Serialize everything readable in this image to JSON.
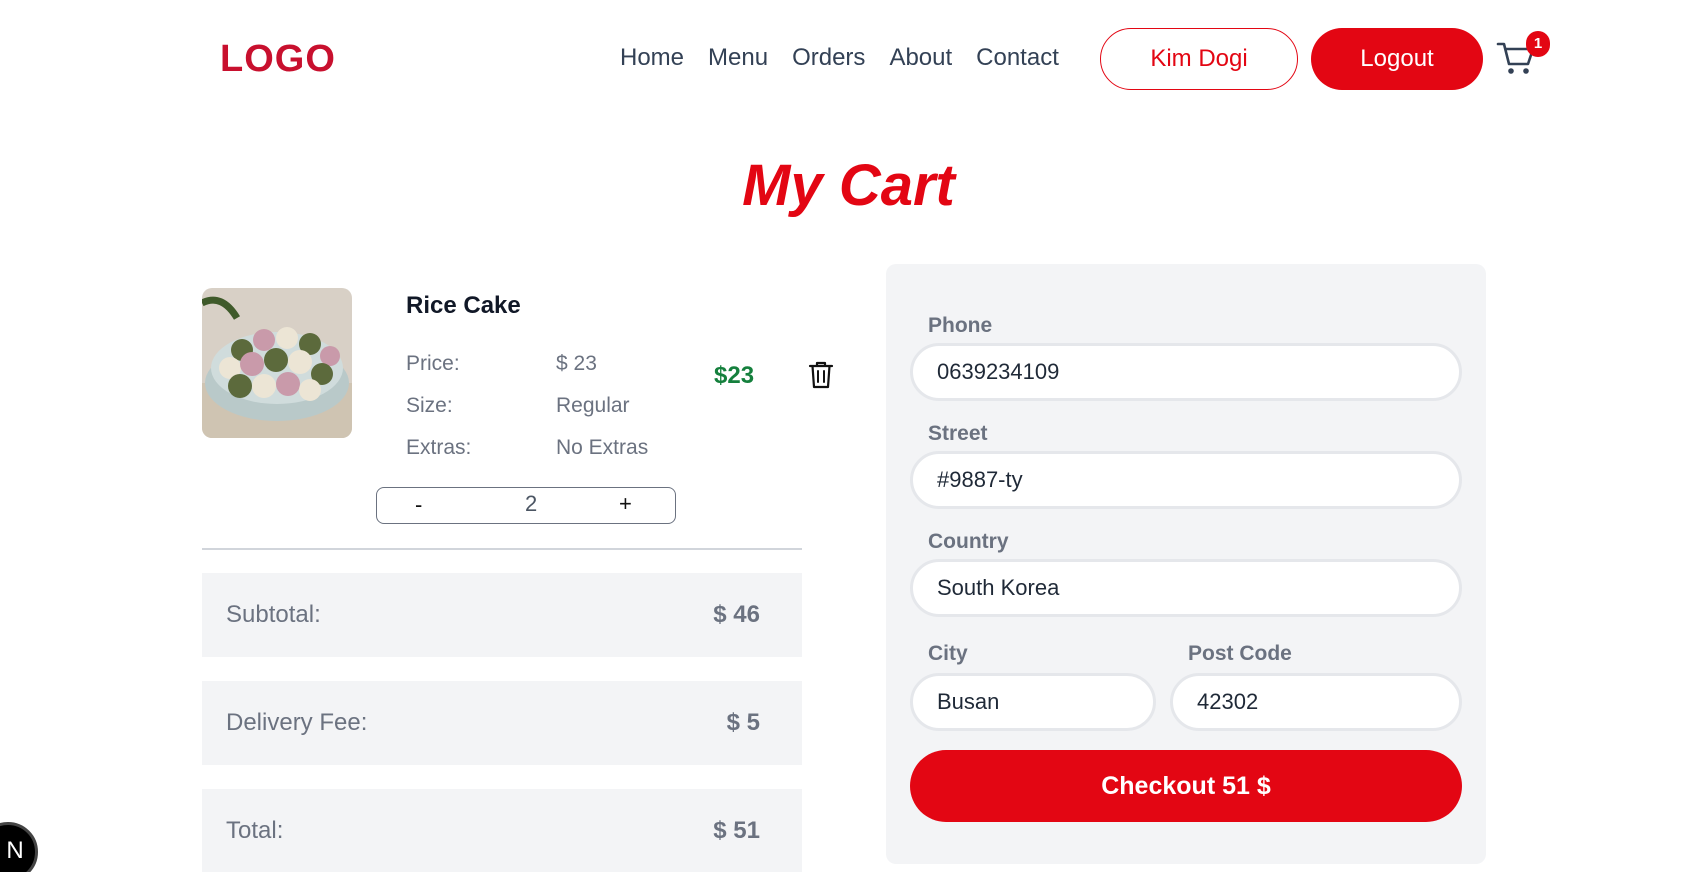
{
  "header": {
    "logo": "LOGO",
    "nav": [
      "Home",
      "Menu",
      "Orders",
      "About",
      "Contact"
    ],
    "user_button": "Kim Dogi",
    "logout_button": "Logout",
    "cart_count": "1",
    "cart_icon": "shopping-cart-icon"
  },
  "page_title": "My Cart",
  "item": {
    "name": "Rice Cake",
    "price_label": "Price:",
    "price_value": "$ 23",
    "size_label": "Size:",
    "size_value": "Regular",
    "extras_label": "Extras:",
    "extras_value": "No Extras",
    "total": "$23",
    "quantity": "2",
    "minus_label": "-",
    "plus_label": "+",
    "delete_icon": "trash-icon"
  },
  "summary": {
    "subtotal_label": "Subtotal:",
    "subtotal_value": "$ 46",
    "delivery_label": "Delivery Fee:",
    "delivery_value": "$ 5",
    "total_label": "Total:",
    "total_value": "$ 51"
  },
  "form": {
    "phone_label": "Phone",
    "phone_value": "0639234109",
    "street_label": "Street",
    "street_value": "#9887-ty",
    "country_label": "Country",
    "country_value": "South Korea",
    "city_label": "City",
    "city_value": "Busan",
    "postcode_label": "Post Code",
    "postcode_value": "42302",
    "checkout_label": "Checkout 51 $"
  },
  "colors": {
    "accent": "#e30613",
    "logo": "#c8102e",
    "price_green": "#15803d",
    "panel_bg": "#f3f4f6"
  },
  "dev_badge": "N"
}
